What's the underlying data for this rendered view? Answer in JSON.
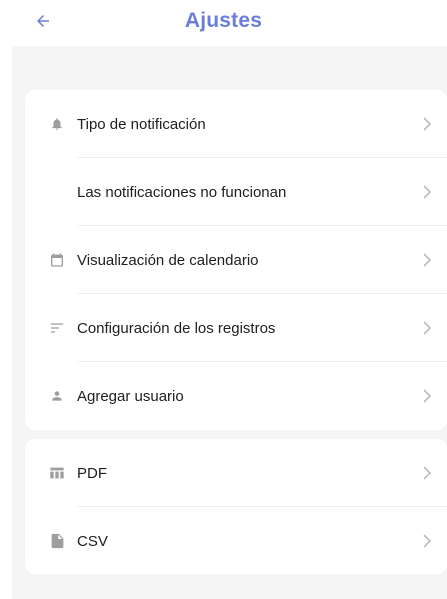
{
  "header": {
    "title": "Ajustes",
    "back_icon": "arrow-left-icon",
    "accent_color": "#6a7ddb"
  },
  "settings_group_1": [
    {
      "label": "Tipo de notificación",
      "icon": "bell-icon"
    },
    {
      "label": "Las notificaciones no funcionan",
      "icon": ""
    },
    {
      "label": "Visualización de calendario",
      "icon": "calendar-icon"
    },
    {
      "label": "Configuración de los registros",
      "icon": "sort-lines-icon"
    },
    {
      "label": "Agregar usuario",
      "icon": "person-icon"
    }
  ],
  "settings_group_2": [
    {
      "label": "PDF",
      "icon": "table-icon"
    },
    {
      "label": "CSV",
      "icon": "file-icon"
    }
  ]
}
